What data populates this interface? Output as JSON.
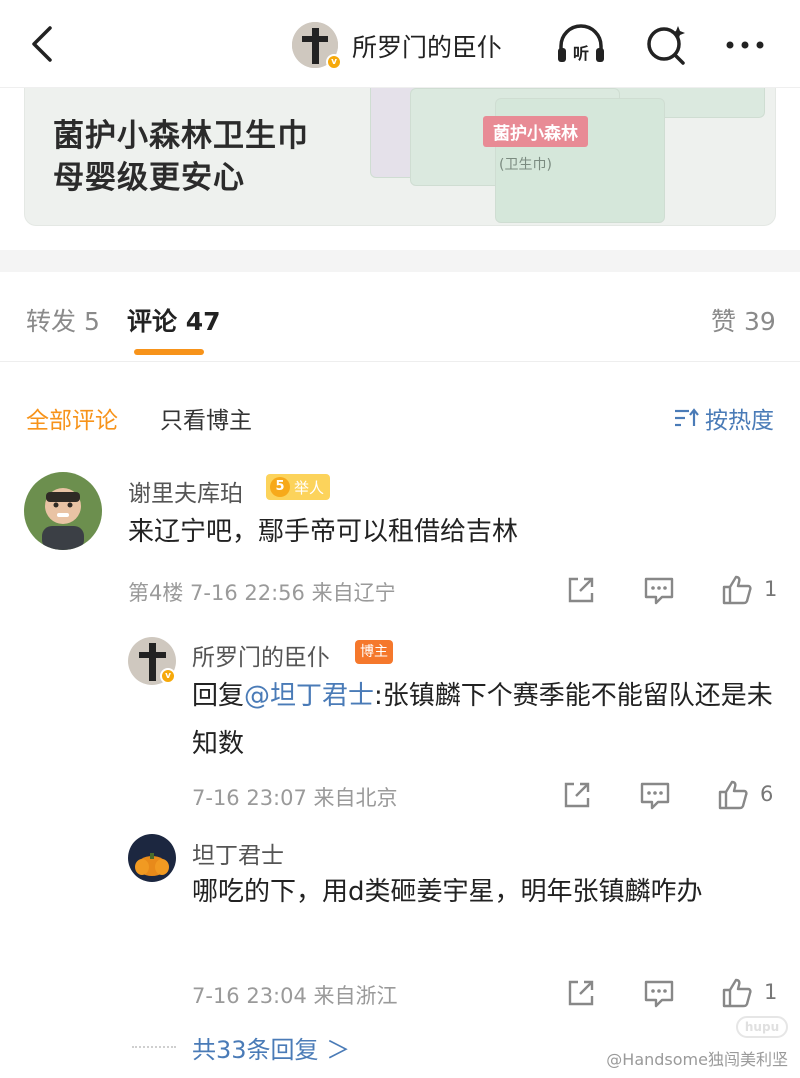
{
  "header": {
    "title": "所罗门的臣仆"
  },
  "ad": {
    "line1": "菌护小森林卫生巾",
    "line2": "母婴级更安心",
    "pack_label": "菌护小森林",
    "pack_sub": "(卫生巾)"
  },
  "tabs": {
    "repost": "转发 5",
    "comments": "评论 47",
    "likes": "赞 39"
  },
  "filters": {
    "all": "全部评论",
    "blogger_only": "只看博主",
    "sort": "按热度"
  },
  "comments": [
    {
      "username": "谢里夫库珀",
      "level": "5",
      "badge": "举人",
      "text": "来辽宁吧，鄢手帝可以租借给吉林",
      "meta": "第4楼  7-16 22:56  来自辽宁",
      "likes": "1"
    }
  ],
  "replies": [
    {
      "username": "所罗门的臣仆",
      "badge": "博主",
      "prefix": "回复",
      "mention": "@坦丁君士",
      "text": ":张镇麟下个赛季能不能留队还是未知数",
      "meta": "7-16 23:07  来自北京",
      "likes": "6"
    },
    {
      "username": "坦丁君士",
      "text": "哪吃的下，用d类砸姜宇星，明年张镇麟咋办",
      "meta": "7-16 23:04  来自浙江",
      "likes": "1"
    }
  ],
  "more_replies": "共33条回复 ＞",
  "watermark": "@Handsome独闯美利坚",
  "hupu_logo": "hupu",
  "colors": {
    "accent": "#f7931a",
    "link": "#4a7bb7",
    "badge_gold": "#fcd35b",
    "badge_orange": "#f5782c"
  },
  "icons": [
    "back-arrow-icon",
    "headphones-listen-icon",
    "search-sparkle-icon",
    "more-dots-icon",
    "sort-icon",
    "share-icon",
    "comment-icon",
    "like-icon"
  ]
}
